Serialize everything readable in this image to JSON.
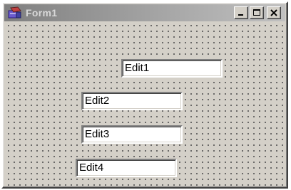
{
  "window": {
    "title": "Form1",
    "icon": "delphi-form-icon"
  },
  "caption_buttons": {
    "minimize_icon": "minimize-icon",
    "maximize_icon": "maximize-icon",
    "close_icon": "close-icon"
  },
  "edits": [
    {
      "text": "Edit1"
    },
    {
      "text": "Edit2"
    },
    {
      "text": "Edit3"
    },
    {
      "text": "Edit4"
    }
  ],
  "colors": {
    "face": "#d4d0c8",
    "title_gradient_start": "#808080",
    "title_gradient_end": "#c0c0c0",
    "grid_dot": "#555555"
  }
}
